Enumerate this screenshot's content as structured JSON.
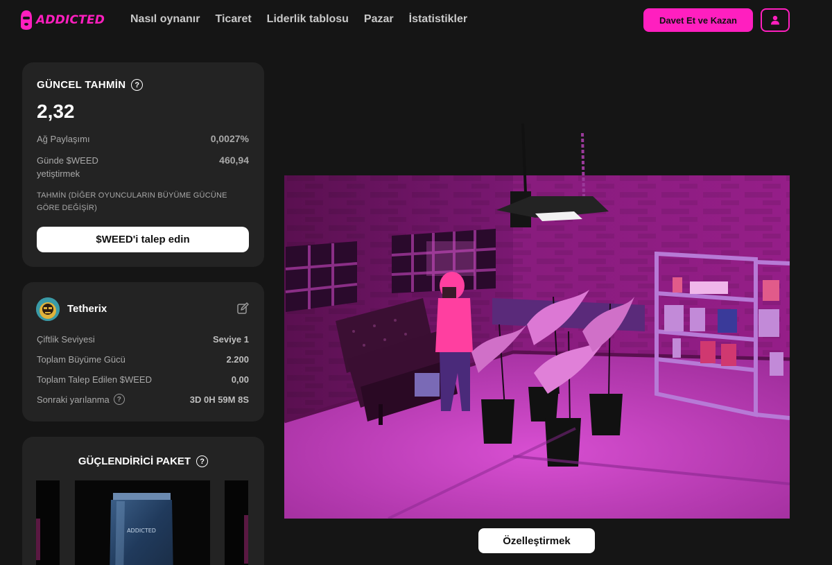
{
  "brand": {
    "name": "ADDICTED",
    "accent": "#ff1fbf"
  },
  "nav": {
    "links": [
      "Nasıl oynanır",
      "Ticaret",
      "Liderlik tablosu",
      "Pazar",
      "İstatistikler"
    ],
    "invite_label": "Davet Et ve Kazan",
    "user_icon": "user-icon"
  },
  "estimate": {
    "title": "GÜNCEL TAHMİN",
    "value": "2,32",
    "network_share_label": "Ağ Paylaşımı",
    "network_share_value": "0,0027%",
    "daily_label_line1": "Günde $WEED",
    "daily_label_line2": "yetiştirmek",
    "daily_value": "460,94",
    "note": "TAHMİN (DİĞER OYUNCULARIN BÜYÜME GÜCÜNE GÖRE DEĞİŞİR)",
    "claim_label": "$WEED'i talep edin"
  },
  "profile": {
    "username": "Tetherix",
    "rows": [
      {
        "label": "Çiftlik Seviyesi",
        "value": "Seviye 1"
      },
      {
        "label": "Toplam Büyüme Gücü",
        "value": "2.200"
      },
      {
        "label": "Toplam Talep Edilen $WEED",
        "value": "0,00"
      },
      {
        "label": "Sonraki yarılanma",
        "value": "3D 0H 59M 8S"
      }
    ]
  },
  "booster": {
    "title": "GÜÇLENDİRİCİ PAKET",
    "pack_text": "ADDICTED"
  },
  "scene": {
    "customize_label": "Özelleştirmek"
  }
}
